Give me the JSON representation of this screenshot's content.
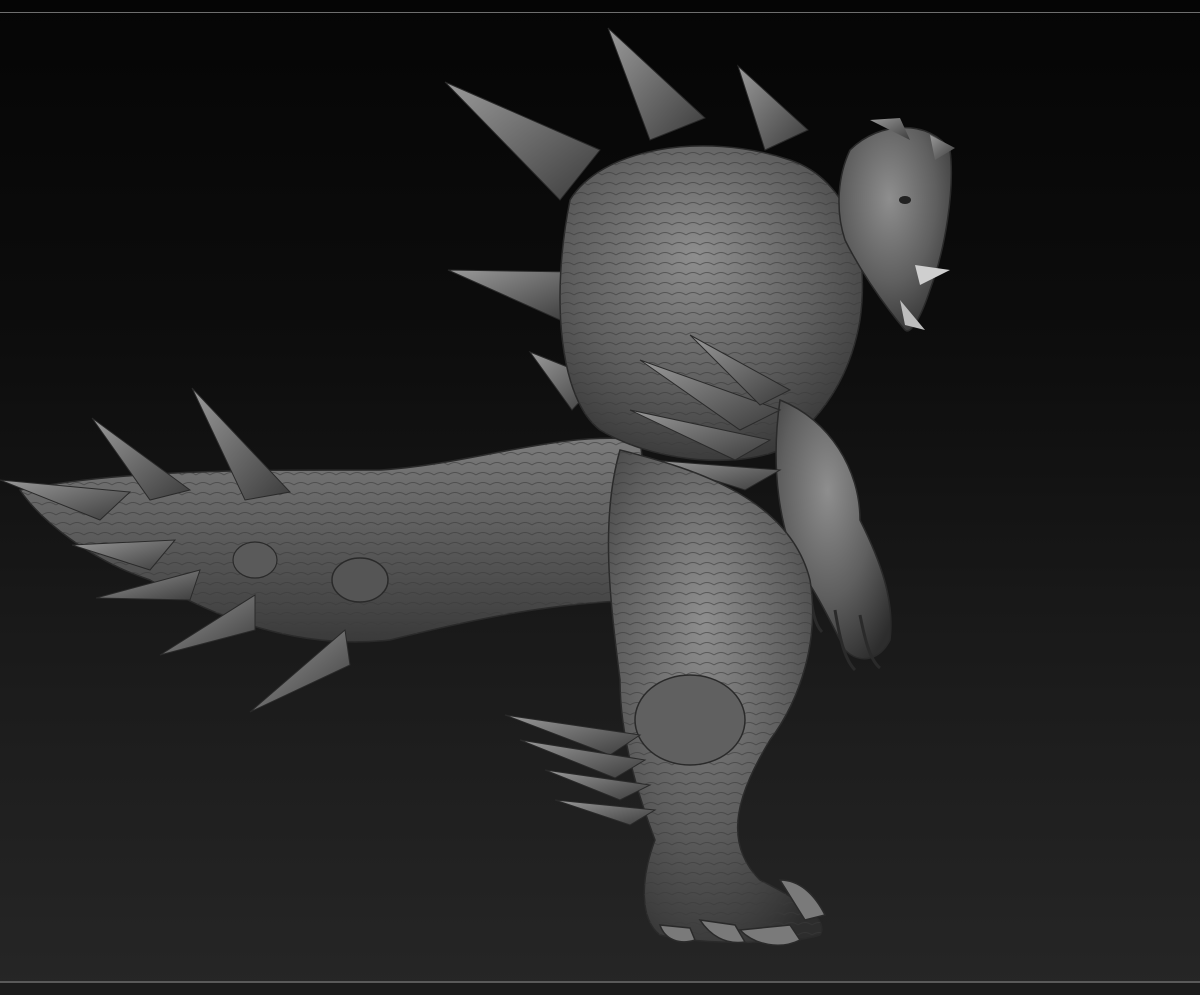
{
  "viewport": {
    "background_top": "#050505",
    "background_bottom": "#262626",
    "frame_line_color": "#6e6e6e"
  },
  "model": {
    "material_light": "#8a8a8a",
    "material_mid": "#5e5e5e",
    "material_dark": "#2e2e2e"
  }
}
